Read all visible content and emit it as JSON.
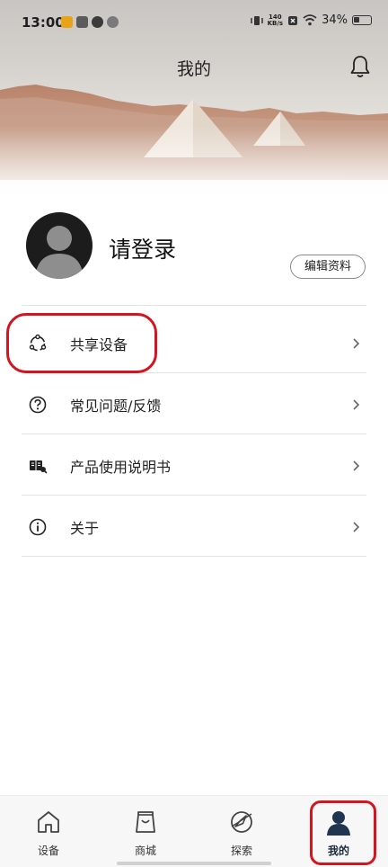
{
  "status_bar": {
    "time": "13:00",
    "net_speed_value": "140",
    "net_speed_unit": "KB/s",
    "battery": "34%"
  },
  "header": {
    "title": "我的",
    "bell_icon": "bell-icon"
  },
  "profile": {
    "login_text": "请登录",
    "edit_button": "编辑资料",
    "avatar_icon": "default-avatar"
  },
  "menu": {
    "items": [
      {
        "label": "共享设备",
        "icon": "share-icon"
      },
      {
        "label": "常见问题/反馈",
        "icon": "help-icon"
      },
      {
        "label": "产品使用说明书",
        "icon": "manual-icon"
      },
      {
        "label": "关于",
        "icon": "info-icon"
      }
    ]
  },
  "bottom_nav": {
    "items": [
      {
        "label": "设备",
        "icon": "home-icon",
        "active": false
      },
      {
        "label": "商城",
        "icon": "shopping-bag-icon",
        "active": false
      },
      {
        "label": "探索",
        "icon": "compass-icon",
        "active": false
      },
      {
        "label": "我的",
        "icon": "person-icon",
        "active": true
      }
    ]
  },
  "colors": {
    "annotation_red": "#d4151f",
    "active_nav": "#1f3550"
  }
}
